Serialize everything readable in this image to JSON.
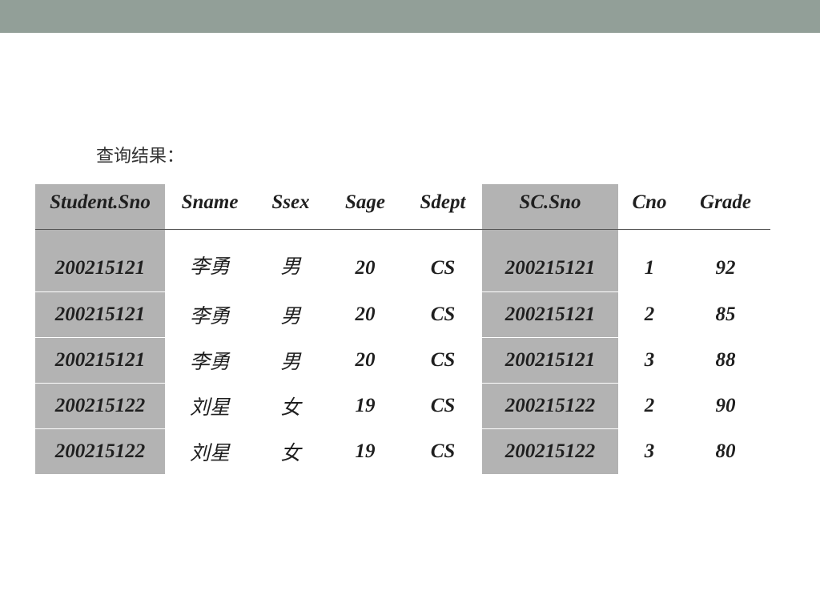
{
  "caption": "查询结果：",
  "table": {
    "headers": [
      "Student.Sno",
      "Sname",
      "Ssex",
      "Sage",
      "Sdept",
      "SC.Sno",
      "Cno",
      "Grade"
    ],
    "rows": [
      [
        "200215121",
        "李勇",
        "男",
        "20",
        "CS",
        "200215121",
        "1",
        "92"
      ],
      [
        "200215121",
        "李勇",
        "男",
        "20",
        "CS",
        "200215121",
        "2",
        "85"
      ],
      [
        "200215121",
        "李勇",
        "男",
        "20",
        "CS",
        "200215121",
        "3",
        "88"
      ],
      [
        "200215122",
        "刘星",
        "女",
        "19",
        "CS",
        "200215122",
        "2",
        "90"
      ],
      [
        "200215122",
        "刘星",
        "女",
        "19",
        "CS",
        "200215122",
        "3",
        "80"
      ]
    ]
  },
  "colors": {
    "top_bar": "#929f98",
    "highlight_column": "#b3b3b3"
  }
}
